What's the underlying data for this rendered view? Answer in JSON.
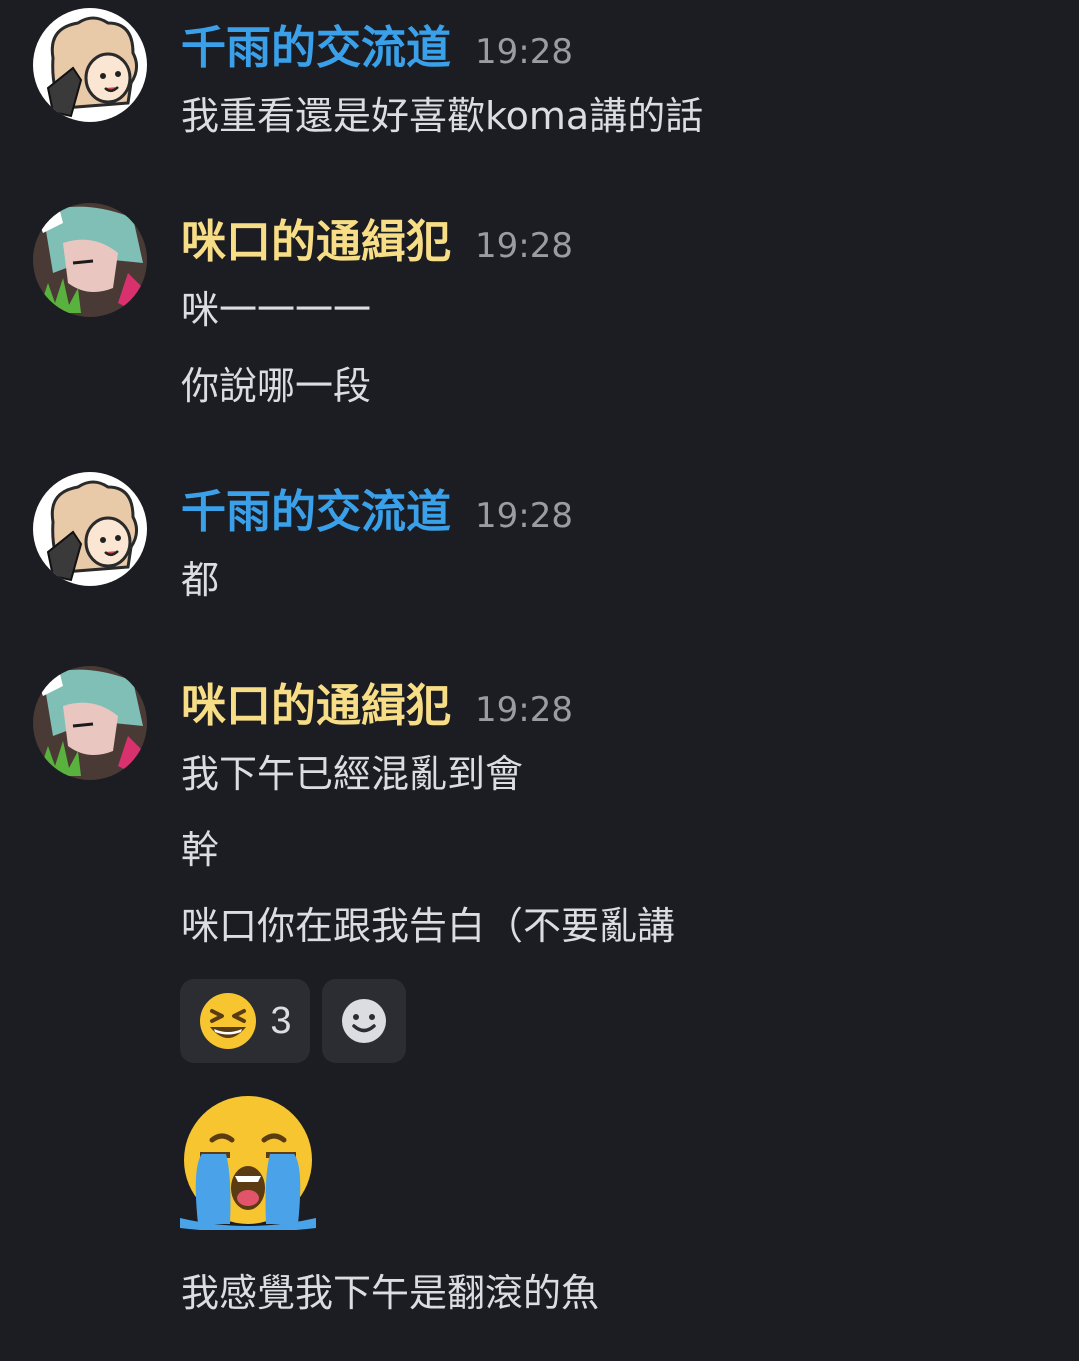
{
  "colors": {
    "background": "#1c1d22",
    "user_blue": "#3aa0ea",
    "user_yellow": "#f7dd86",
    "timestamp": "#9b9ca3",
    "text": "#dcdde1"
  },
  "groups": [
    {
      "username": "千雨的交流道",
      "time": "19:28",
      "avatar": "cartoon-girl-avatar",
      "messages": [
        "我重看還是好喜歡koma講的話"
      ]
    },
    {
      "username": "咪口的通緝犯",
      "time": "19:28",
      "avatar": "anime-character-avatar",
      "messages": [
        "咪一一一一",
        "你說哪一段"
      ]
    },
    {
      "username": "千雨的交流道",
      "time": "19:28",
      "avatar": "cartoon-girl-avatar",
      "messages": [
        "都"
      ]
    },
    {
      "username": "咪口的通緝犯",
      "time": "19:28",
      "avatar": "anime-character-avatar",
      "messages": [
        "我下午已經混亂到會",
        "幹",
        "咪口你在跟我告白（不要亂講"
      ]
    }
  ],
  "reactions": [
    {
      "emoji": "laughing-face-icon",
      "count": "3"
    },
    {
      "emoji": "add-reaction-icon"
    }
  ],
  "big_emoji": "loudly-crying-face-icon",
  "final_message": "我感覺我下午是翻滾的魚"
}
